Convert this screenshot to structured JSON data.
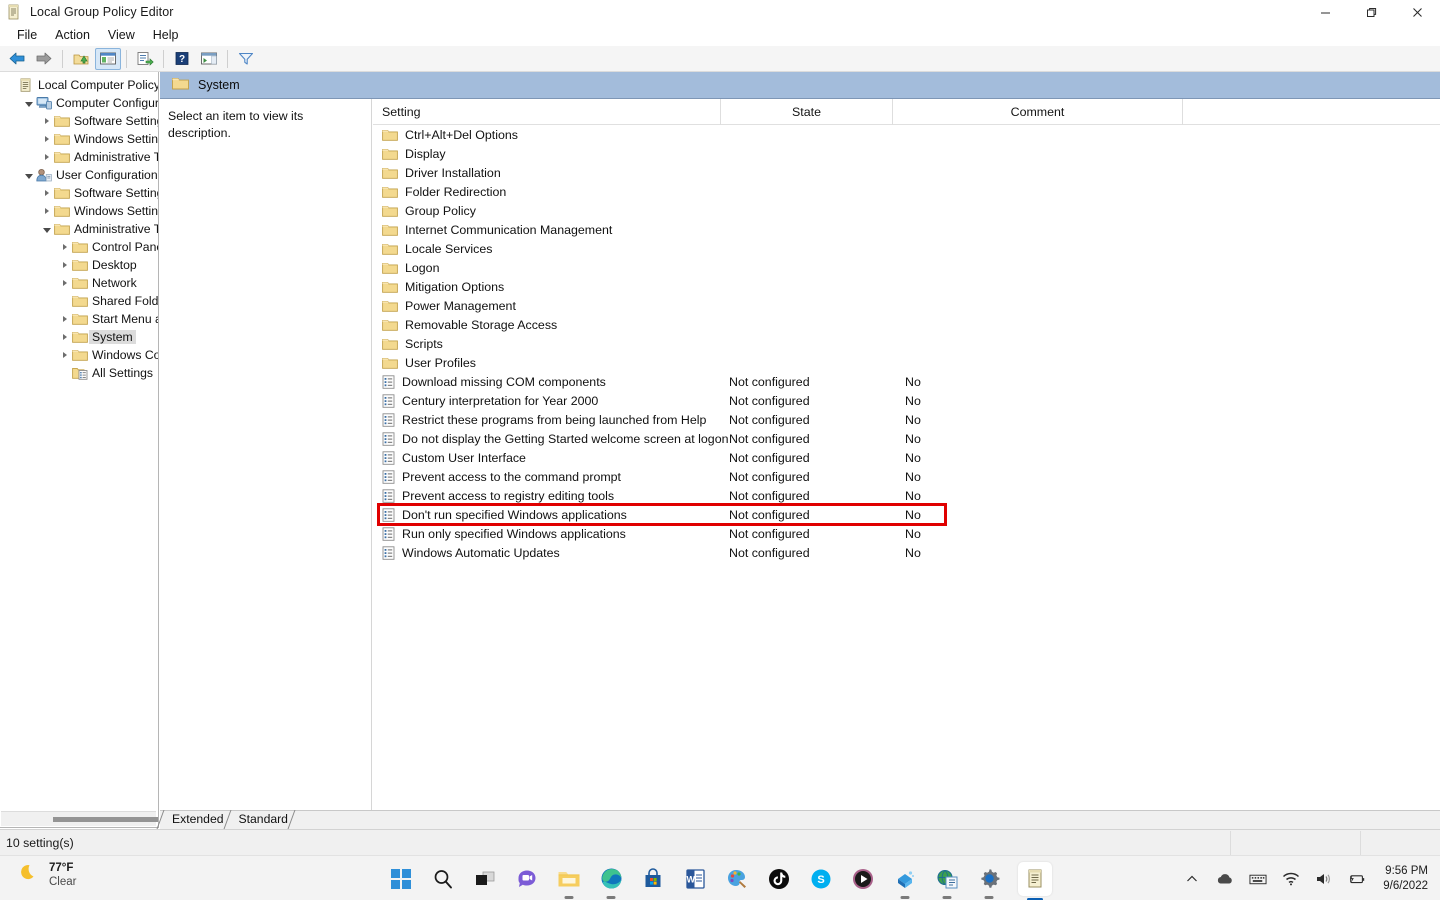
{
  "window": {
    "title": "Local Group Policy Editor",
    "icon": "gpedit-scroll-icon",
    "controls": {
      "minimize": "—",
      "maximize": "❐",
      "close": "✕"
    }
  },
  "menubar": {
    "items": [
      "File",
      "Action",
      "View",
      "Help"
    ]
  },
  "toolbar": {
    "buttons": [
      {
        "name": "back-button",
        "icon": "left-arrow-icon"
      },
      {
        "name": "forward-button",
        "icon": "right-arrow-icon"
      },
      {
        "name": "up-one-level-button",
        "icon": "folder-up-icon"
      },
      {
        "name": "show-hide-tree-button",
        "icon": "console-tree-icon",
        "active": true
      },
      {
        "name": "export-list-button",
        "icon": "export-list-icon"
      },
      {
        "name": "help-button",
        "icon": "question-mark-icon"
      },
      {
        "name": "show-hide-action-pane-button",
        "icon": "action-pane-icon"
      },
      {
        "name": "filter-button",
        "icon": "funnel-icon"
      }
    ]
  },
  "tree": {
    "nodes": [
      {
        "label": "Local Computer Policy",
        "indent": 0,
        "expander": "none",
        "icon": "policy-scroll-icon",
        "selected": false
      },
      {
        "label": "Computer Configura",
        "indent": 1,
        "expander": "open",
        "icon": "computer-icon",
        "selected": false
      },
      {
        "label": "Software Settings",
        "indent": 2,
        "expander": "closed",
        "icon": "folder-icon",
        "selected": false
      },
      {
        "label": "Windows Setting",
        "indent": 2,
        "expander": "closed",
        "icon": "folder-icon",
        "selected": false
      },
      {
        "label": "Administrative Te",
        "indent": 2,
        "expander": "closed",
        "icon": "folder-icon",
        "selected": false
      },
      {
        "label": "User Configuration",
        "indent": 1,
        "expander": "open",
        "icon": "user-icon",
        "selected": false
      },
      {
        "label": "Software Settings",
        "indent": 2,
        "expander": "closed",
        "icon": "folder-icon",
        "selected": false
      },
      {
        "label": "Windows Setting",
        "indent": 2,
        "expander": "closed",
        "icon": "folder-icon",
        "selected": false
      },
      {
        "label": "Administrative Te",
        "indent": 2,
        "expander": "open",
        "icon": "folder-icon",
        "selected": false
      },
      {
        "label": "Control Panel",
        "indent": 3,
        "expander": "closed",
        "icon": "folder-icon",
        "selected": false
      },
      {
        "label": "Desktop",
        "indent": 3,
        "expander": "closed",
        "icon": "folder-icon",
        "selected": false
      },
      {
        "label": "Network",
        "indent": 3,
        "expander": "closed",
        "icon": "folder-icon",
        "selected": false
      },
      {
        "label": "Shared Folder",
        "indent": 3,
        "expander": "none",
        "icon": "folder-icon",
        "selected": false
      },
      {
        "label": "Start Menu ar",
        "indent": 3,
        "expander": "closed",
        "icon": "folder-icon",
        "selected": false
      },
      {
        "label": "System",
        "indent": 3,
        "expander": "closed",
        "icon": "folder-icon",
        "selected": true
      },
      {
        "label": "Windows Cor",
        "indent": 3,
        "expander": "closed",
        "icon": "folder-icon",
        "selected": false
      },
      {
        "label": "All Settings",
        "indent": 3,
        "expander": "none",
        "icon": "all-settings-icon",
        "selected": false
      }
    ]
  },
  "pane": {
    "header_title": "System",
    "header_icon": "folder-icon",
    "description": "Select an item to view its description."
  },
  "list": {
    "columns": [
      "Setting",
      "State",
      "Comment"
    ],
    "rows": [
      {
        "name": "Ctrl+Alt+Del Options",
        "state": "",
        "comment": "",
        "icon": "folder-icon"
      },
      {
        "name": "Display",
        "state": "",
        "comment": "",
        "icon": "folder-icon"
      },
      {
        "name": "Driver Installation",
        "state": "",
        "comment": "",
        "icon": "folder-icon"
      },
      {
        "name": "Folder Redirection",
        "state": "",
        "comment": "",
        "icon": "folder-icon"
      },
      {
        "name": "Group Policy",
        "state": "",
        "comment": "",
        "icon": "folder-icon"
      },
      {
        "name": "Internet Communication Management",
        "state": "",
        "comment": "",
        "icon": "folder-icon"
      },
      {
        "name": "Locale Services",
        "state": "",
        "comment": "",
        "icon": "folder-icon"
      },
      {
        "name": "Logon",
        "state": "",
        "comment": "",
        "icon": "folder-icon"
      },
      {
        "name": "Mitigation Options",
        "state": "",
        "comment": "",
        "icon": "folder-icon"
      },
      {
        "name": "Power Management",
        "state": "",
        "comment": "",
        "icon": "folder-icon"
      },
      {
        "name": "Removable Storage Access",
        "state": "",
        "comment": "",
        "icon": "folder-icon"
      },
      {
        "name": "Scripts",
        "state": "",
        "comment": "",
        "icon": "folder-icon"
      },
      {
        "name": "User Profiles",
        "state": "",
        "comment": "",
        "icon": "folder-icon"
      },
      {
        "name": "Download missing COM components",
        "state": "Not configured",
        "comment": "No",
        "icon": "policy-icon"
      },
      {
        "name": "Century interpretation for Year 2000",
        "state": "Not configured",
        "comment": "No",
        "icon": "policy-icon"
      },
      {
        "name": "Restrict these programs from being launched from Help",
        "state": "Not configured",
        "comment": "No",
        "icon": "policy-icon"
      },
      {
        "name": "Do not display the Getting Started welcome screen at logon",
        "state": "Not configured",
        "comment": "No",
        "icon": "policy-icon"
      },
      {
        "name": "Custom User Interface",
        "state": "Not configured",
        "comment": "No",
        "icon": "policy-icon"
      },
      {
        "name": "Prevent access to the command prompt",
        "state": "Not configured",
        "comment": "No",
        "icon": "policy-icon"
      },
      {
        "name": "Prevent access to registry editing tools",
        "state": "Not configured",
        "comment": "No",
        "icon": "policy-icon"
      },
      {
        "name": "Don't run specified Windows applications",
        "state": "Not configured",
        "comment": "No",
        "icon": "policy-icon",
        "highlighted": true
      },
      {
        "name": "Run only specified Windows applications",
        "state": "Not configured",
        "comment": "No",
        "icon": "policy-icon"
      },
      {
        "name": "Windows Automatic Updates",
        "state": "Not configured",
        "comment": "No",
        "icon": "policy-icon"
      }
    ],
    "highlight_color": "#e00000"
  },
  "tabs": {
    "items": [
      "Extended",
      "Standard"
    ],
    "selected": "Standard"
  },
  "statusbar": {
    "text": "10 setting(s)"
  },
  "taskbar": {
    "weather": {
      "temperature": "77°F",
      "condition": "Clear",
      "icon": "moon-icon"
    },
    "apps": [
      {
        "name": "start-button",
        "icon": "windows-logo-icon"
      },
      {
        "name": "search-button",
        "icon": "search-icon"
      },
      {
        "name": "task-view-button",
        "icon": "task-view-icon"
      },
      {
        "name": "chat-button",
        "icon": "chat-video-icon"
      },
      {
        "name": "file-explorer-button",
        "icon": "folder-icon",
        "running": true
      },
      {
        "name": "microsoft-edge-button",
        "icon": "edge-icon",
        "running": true
      },
      {
        "name": "microsoft-store-button",
        "icon": "store-icon"
      },
      {
        "name": "word-button",
        "icon": "word-icon"
      },
      {
        "name": "paint-button",
        "icon": "paint-palette-icon"
      },
      {
        "name": "tiktok-button",
        "icon": "tiktok-icon"
      },
      {
        "name": "skype-button",
        "icon": "skype-icon"
      },
      {
        "name": "media-player-button",
        "icon": "play-circle-icon"
      },
      {
        "name": "blender-button",
        "icon": "blender-icon",
        "running": true
      },
      {
        "name": "network-tool-button",
        "icon": "globe-doc-icon",
        "running": true
      },
      {
        "name": "settings-button",
        "icon": "gear-icon",
        "running": true
      },
      {
        "name": "group-policy-editor-button",
        "icon": "gpedit-scroll-icon",
        "focused": true
      }
    ],
    "tray": [
      {
        "name": "show-hidden-icons",
        "icon": "chevron-up-icon"
      },
      {
        "name": "onedrive-icon",
        "icon": "cloud-icon"
      },
      {
        "name": "keyboard-layout-icon",
        "icon": "keyboard-icon"
      },
      {
        "name": "wifi-icon",
        "icon": "wifi-icon"
      },
      {
        "name": "volume-icon",
        "icon": "speaker-icon"
      },
      {
        "name": "battery-icon",
        "icon": "battery-charging-icon"
      }
    ],
    "clock": {
      "time": "9:56 PM",
      "date": "9/6/2022"
    }
  }
}
